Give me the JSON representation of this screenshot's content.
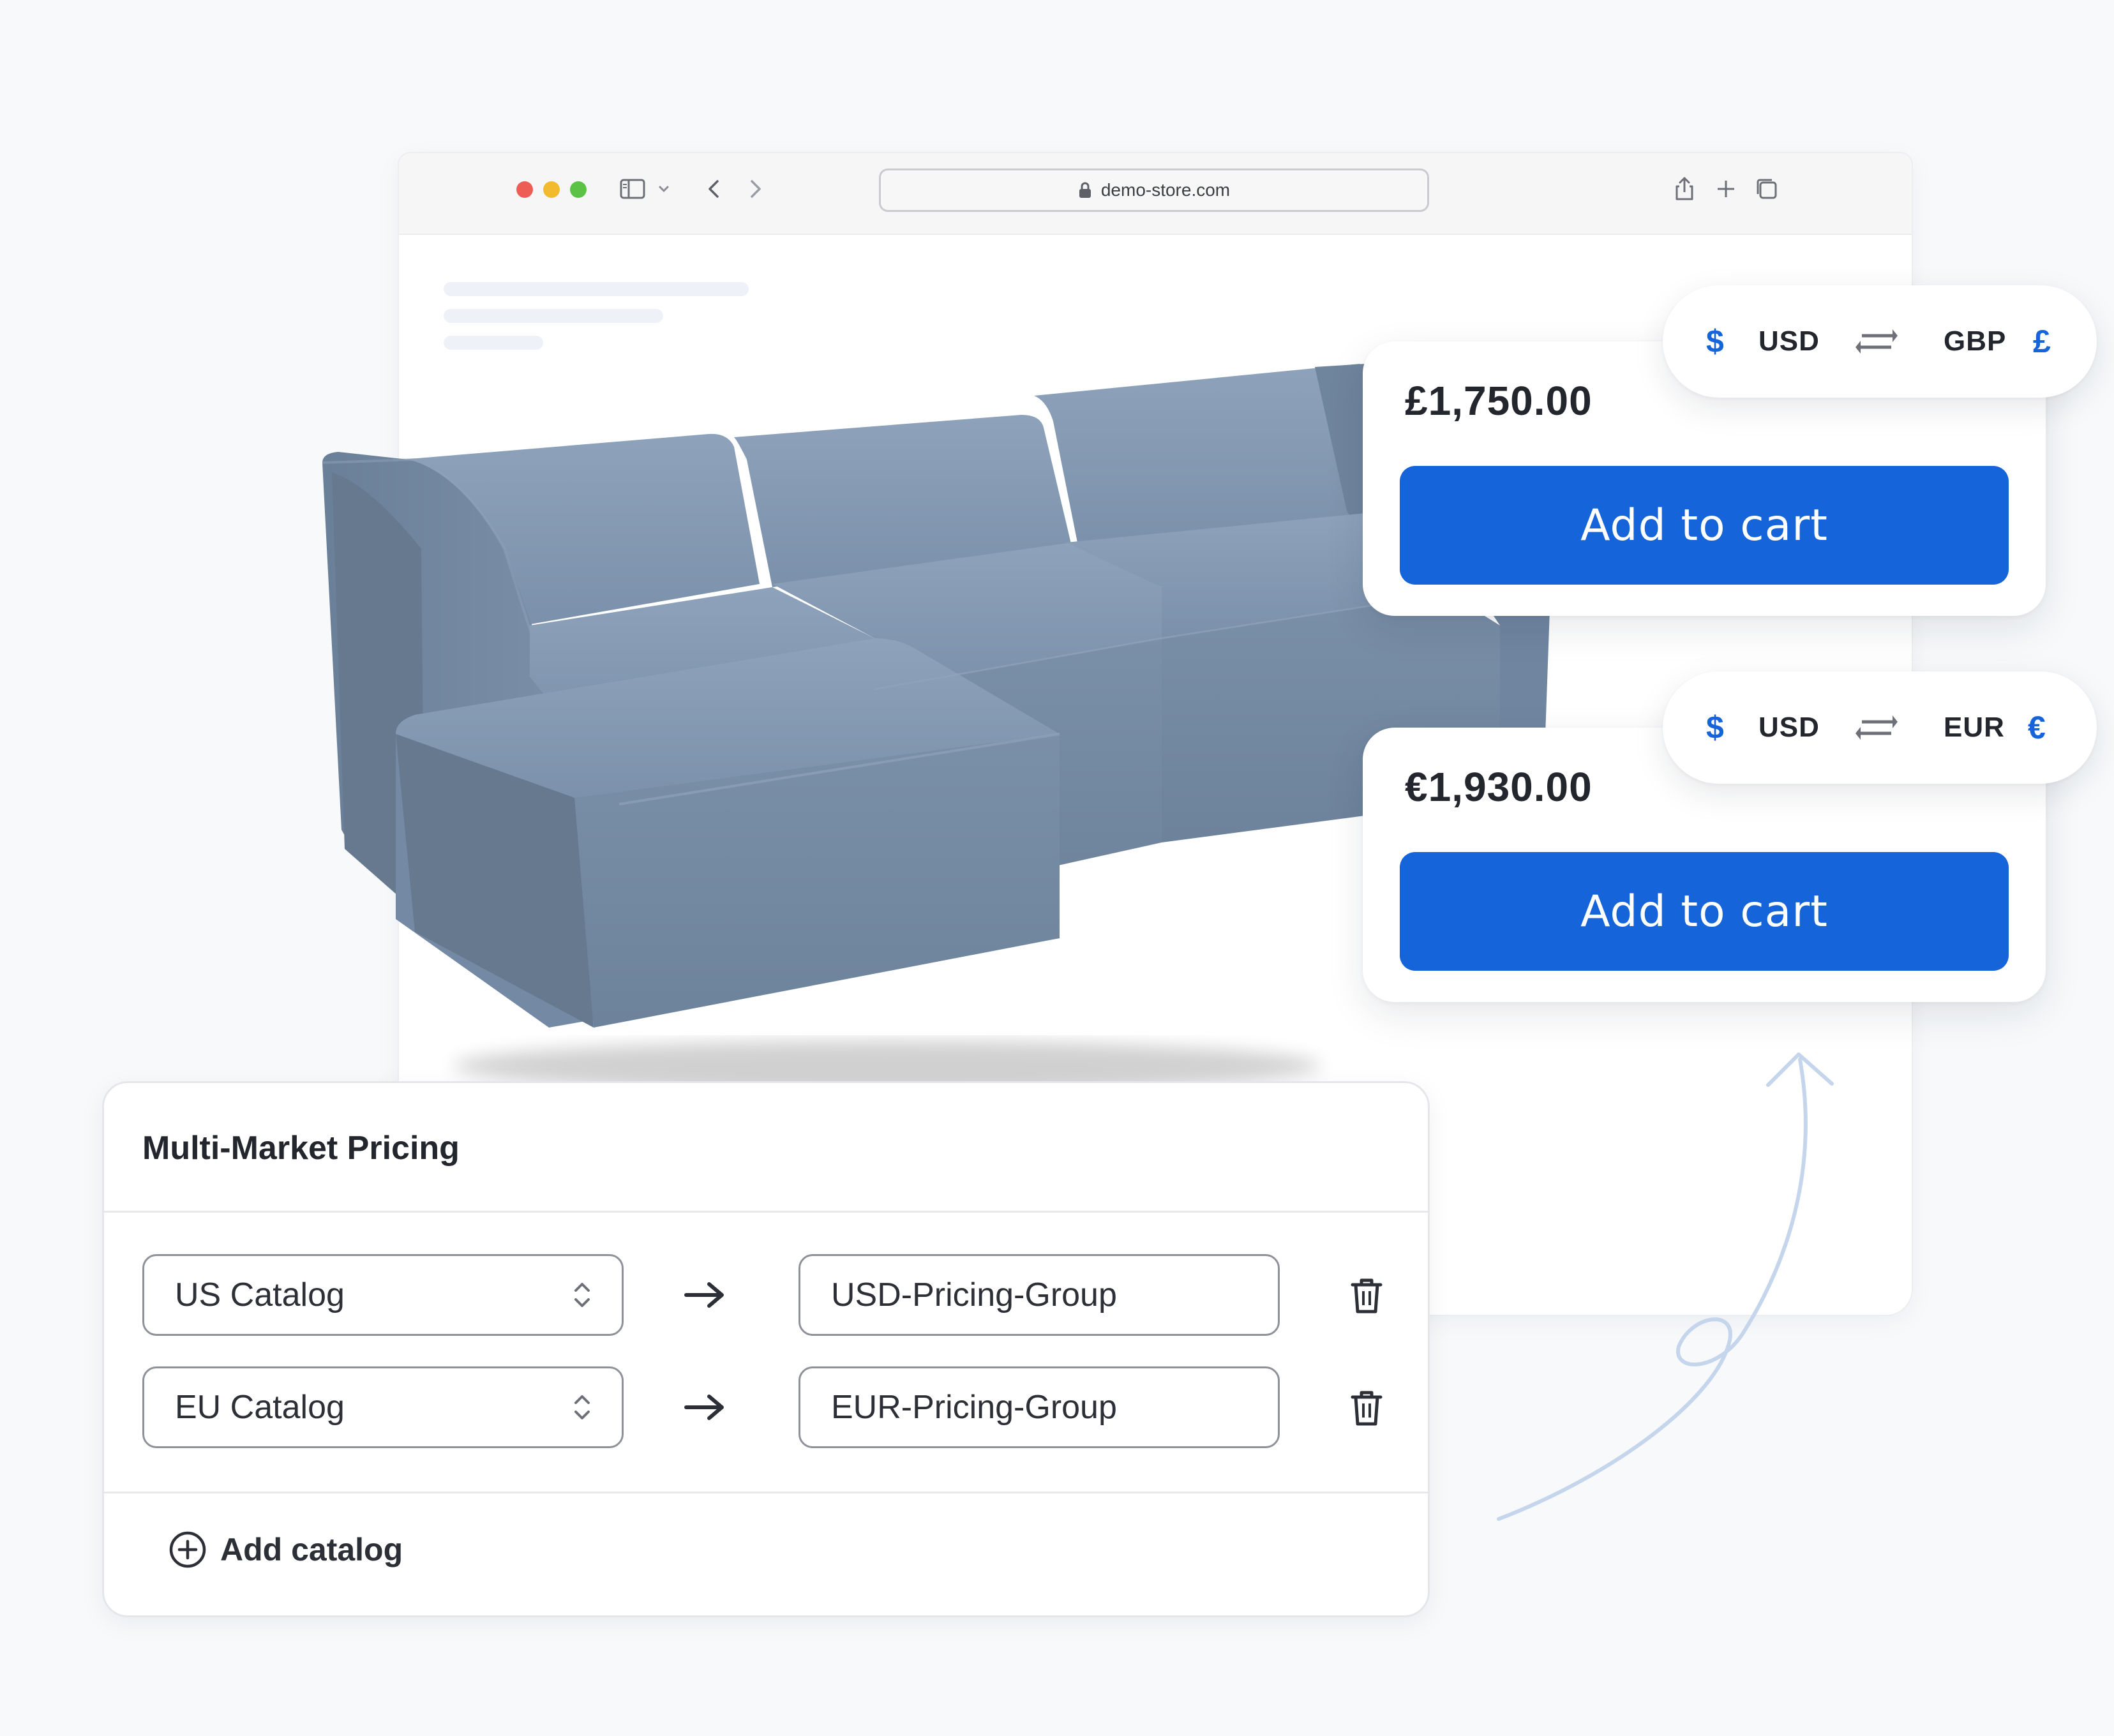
{
  "browser": {
    "url": "demo-store.com"
  },
  "price_cards": [
    {
      "price": "£1,750.00",
      "button_label": "Add to cart",
      "from_symbol": "$",
      "from_code": "USD",
      "to_code": "GBP",
      "to_symbol": "£"
    },
    {
      "price": "€1,930.00",
      "button_label": "Add to cart",
      "from_symbol": "$",
      "from_code": "USD",
      "to_code": "EUR",
      "to_symbol": "€"
    }
  ],
  "pricing_panel": {
    "title": "Multi-Market Pricing",
    "rows": [
      {
        "catalog": "US Catalog",
        "pricing_group": "USD-Pricing-Group"
      },
      {
        "catalog": "EU Catalog",
        "pricing_group": "EUR-Pricing-Group"
      }
    ],
    "add_label": "Add catalog"
  },
  "colors": {
    "accent": "#1664d9",
    "sofa": "#7a90aa",
    "background": "#f7f9fb"
  },
  "icons": [
    "sidebar-icon",
    "chevron-down-icon",
    "back-icon",
    "forward-icon",
    "lock-icon",
    "share-icon",
    "plus-icon",
    "tabs-icon",
    "swap-icon",
    "arrow-right-icon",
    "trash-icon",
    "add-circle-icon",
    "updown-chevron-icon"
  ]
}
